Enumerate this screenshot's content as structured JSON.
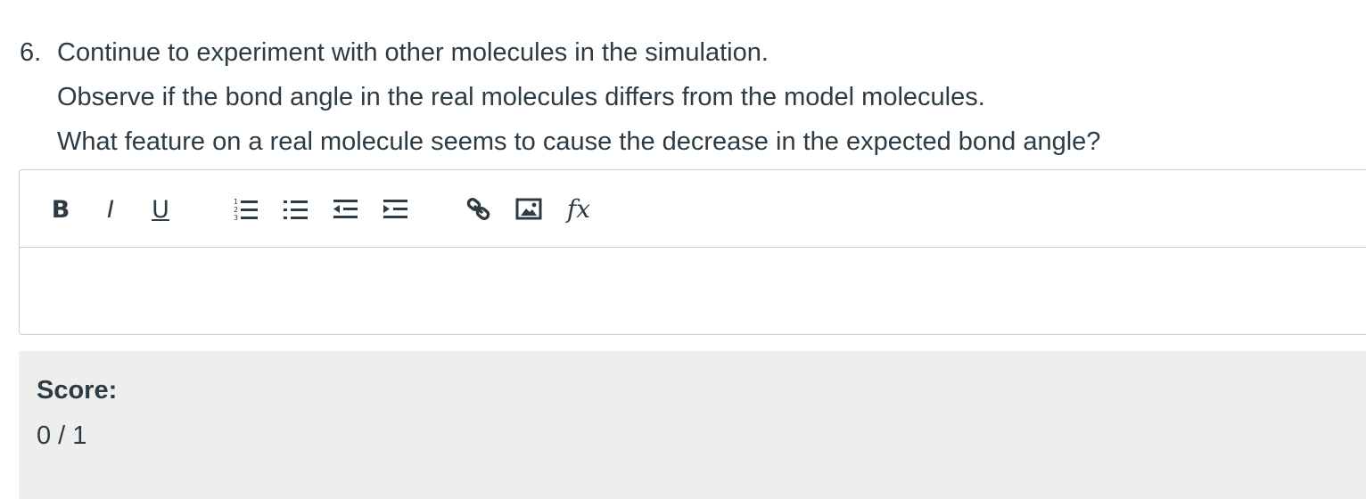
{
  "question": {
    "number": "6.",
    "lines": [
      "Continue to experiment with other molecules in the simulation.",
      "Observe if the bond angle in the real molecules differs from the model molecules.",
      "What feature on a real molecule seems to cause the decrease in the expected bond angle?"
    ]
  },
  "toolbar": {
    "bold_label": "B",
    "italic_label": "I",
    "underline_label": "U",
    "formula_label": "fx",
    "icons": [
      "bold-icon",
      "italic-icon",
      "underline-icon",
      "numbered-list-icon",
      "bullet-list-icon",
      "outdent-icon",
      "indent-icon",
      "link-icon",
      "image-icon",
      "formula-icon"
    ]
  },
  "editor": {
    "value": ""
  },
  "score": {
    "label": "Score:",
    "value": "0 / 1"
  }
}
